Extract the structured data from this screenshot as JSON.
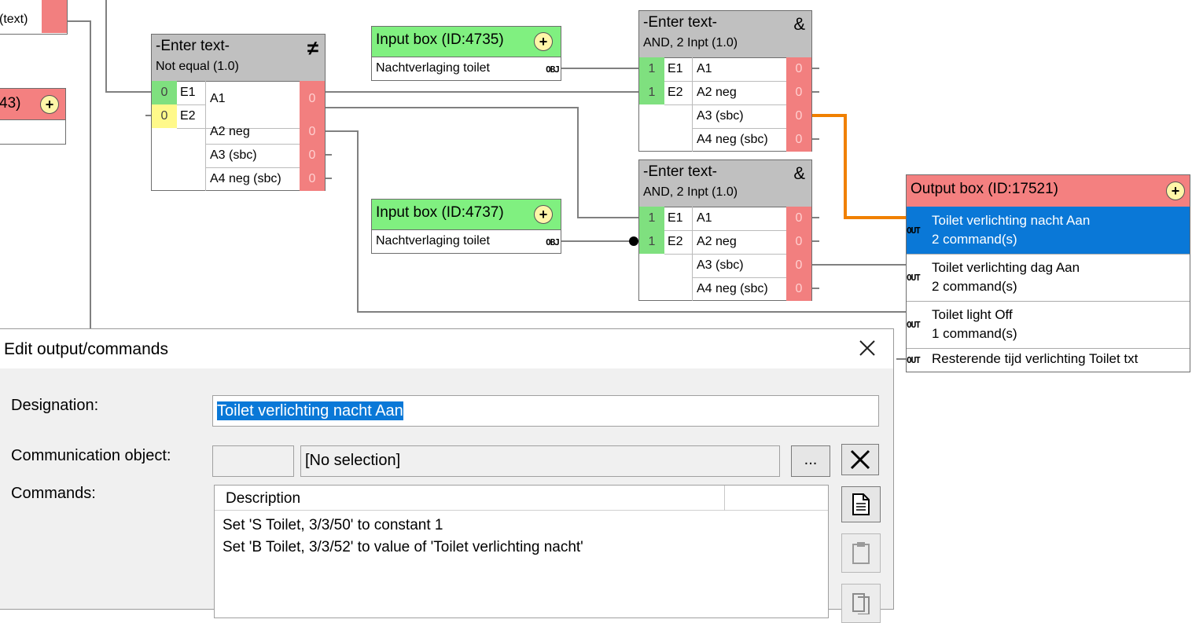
{
  "left_partial": {
    "text_label": "(text)",
    "value_label": "43)"
  },
  "not_equal_gate": {
    "title": "-Enter text-",
    "subtitle": "Not equal (1.0)",
    "symbol": "≠",
    "inputs": [
      {
        "value": "0",
        "name": "E1"
      },
      {
        "value": "0",
        "name": "E2"
      }
    ],
    "outputs": [
      {
        "name": "A1",
        "value": "0"
      },
      {
        "name": "A2 neg",
        "value": "0"
      },
      {
        "name": "A3 (sbc)",
        "value": "0"
      },
      {
        "name": "A4 neg (sbc)",
        "value": "0"
      }
    ]
  },
  "input_box_1": {
    "title": "Input box (ID:4735)",
    "row": "Nachtverlaging toilet",
    "obj": "OBJ"
  },
  "input_box_2": {
    "title": "Input box (ID:4737)",
    "row": "Nachtverlaging toilet",
    "obj": "OBJ"
  },
  "and_gate_1": {
    "title": "-Enter text-",
    "subtitle": "AND, 2 Inpt (1.0)",
    "symbol": "&",
    "inputs": [
      {
        "value": "1",
        "name": "E1"
      },
      {
        "value": "1",
        "name": "E2"
      }
    ],
    "outputs": [
      {
        "name": "A1",
        "value": "0"
      },
      {
        "name": "A2 neg",
        "value": "0"
      },
      {
        "name": "A3 (sbc)",
        "value": "0"
      },
      {
        "name": "A4 neg (sbc)",
        "value": "0"
      }
    ]
  },
  "and_gate_2": {
    "title": "-Enter text-",
    "subtitle": "AND, 2 Inpt (1.0)",
    "symbol": "&",
    "inputs": [
      {
        "value": "1",
        "name": "E1"
      },
      {
        "value": "1",
        "name": "E2"
      }
    ],
    "outputs": [
      {
        "name": "A1",
        "value": "0"
      },
      {
        "name": "A2 neg",
        "value": "0"
      },
      {
        "name": "A3 (sbc)",
        "value": "0"
      },
      {
        "name": "A4 neg (sbc)",
        "value": "0"
      }
    ]
  },
  "output_box": {
    "title": "Output box (ID:17521)",
    "out_tag": "OUT",
    "rows": [
      {
        "line1": "Toilet verlichting nacht Aan",
        "line2": "2 command(s)"
      },
      {
        "line1": "Toilet verlichting dag Aan",
        "line2": "2 command(s)"
      },
      {
        "line1": "Toilet light Off",
        "line2": "1 command(s)"
      },
      {
        "line1": "Resterende tijd verlichting Toilet txt",
        "line2": ""
      }
    ]
  },
  "dialog": {
    "title": "Edit output/commands",
    "designation_label": "Designation:",
    "designation_value": "Toilet verlichting nacht Aan",
    "comm_label": "Communication object:",
    "comm_value": "[No selection]",
    "browse_label": "...",
    "commands_label": "Commands:",
    "column_header": "Description",
    "commands": [
      "Set 'S Toilet, 3/3/50' to constant 1",
      "Set 'B Toilet, 3/3/52' to value of 'Toilet verlichting nacht'"
    ]
  },
  "colors": {
    "gate_header": "#c0c0c0",
    "input_header": "#80f080",
    "output_header": "#f48080",
    "selected_row": "#0a78d7",
    "active_wire": "#f08000",
    "wire": "#808080"
  }
}
